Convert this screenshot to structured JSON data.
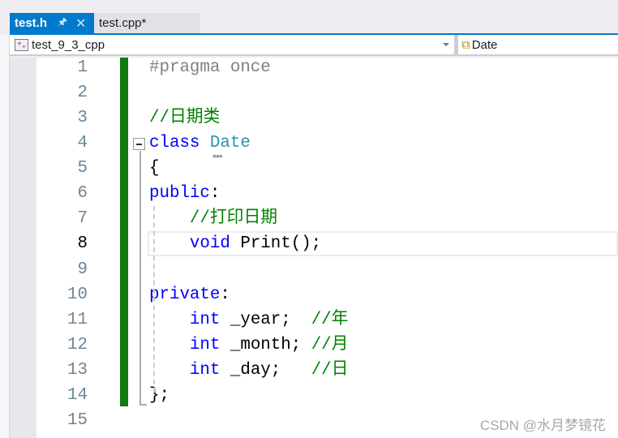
{
  "tabs": [
    {
      "label": "test.h",
      "active": true,
      "pin_icon": "pin-icon",
      "close_icon": "close-icon"
    },
    {
      "label": "test.cpp*",
      "active": false
    }
  ],
  "navbar": {
    "project": "test_9_3_cpp",
    "project_icon": "project-icon",
    "member": "Date",
    "member_icon": "class-icon"
  },
  "colors": {
    "keyword": "#0000ff",
    "comment": "#008000",
    "type": "#2b91af",
    "preprocessor": "#808080",
    "change_bar": "#107c10",
    "accent": "#007acc"
  },
  "current_line": 8,
  "lines": [
    [
      [
        "pp",
        "#pragma once"
      ]
    ],
    [],
    [
      [
        "cm",
        "//日期类"
      ]
    ],
    [
      [
        "kw",
        "class"
      ],
      [
        "tx",
        " "
      ],
      [
        "ty",
        "Date"
      ]
    ],
    [
      [
        "tx",
        "{"
      ]
    ],
    [
      [
        "kw",
        "public"
      ],
      [
        "tx",
        ":"
      ]
    ],
    [
      [
        "tx",
        "    "
      ],
      [
        "cm",
        "//打印日期"
      ]
    ],
    [
      [
        "tx",
        "    "
      ],
      [
        "kw",
        "void"
      ],
      [
        "tx",
        " Print();"
      ]
    ],
    [],
    [
      [
        "kw",
        "private"
      ],
      [
        "tx",
        ":"
      ]
    ],
    [
      [
        "tx",
        "    "
      ],
      [
        "kw",
        "int"
      ],
      [
        "tx",
        " _year;  "
      ],
      [
        "cm",
        "//年"
      ]
    ],
    [
      [
        "tx",
        "    "
      ],
      [
        "kw",
        "int"
      ],
      [
        "tx",
        " _month; "
      ],
      [
        "cm",
        "//月"
      ]
    ],
    [
      [
        "tx",
        "    "
      ],
      [
        "kw",
        "int"
      ],
      [
        "tx",
        " _day;   "
      ],
      [
        "cm",
        "//日"
      ]
    ],
    [
      [
        "tx",
        "};"
      ]
    ],
    []
  ],
  "watermark": "CSDN @水月梦镜花"
}
